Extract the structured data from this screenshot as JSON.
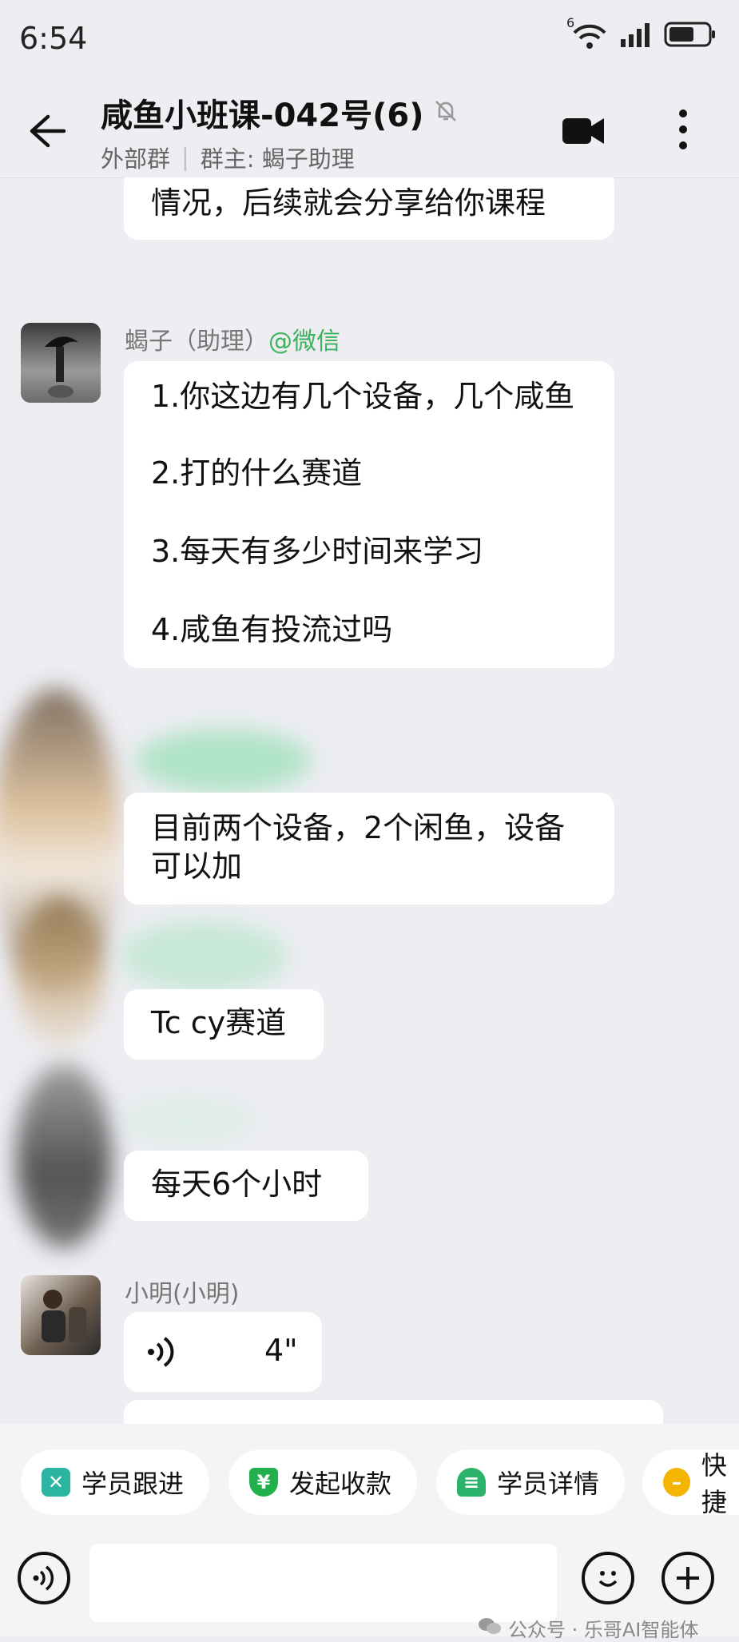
{
  "status": {
    "time": "6:54",
    "network": "6"
  },
  "header": {
    "title": "咸鱼小班课-042号(6)",
    "subtitle_type": "外部群",
    "subtitle_owner": "群主: 蝎子助理",
    "icons": {
      "back": "back-arrow-icon",
      "mute": "mute-bell-icon",
      "video": "video-call-icon",
      "more": "more-vertical-icon"
    }
  },
  "messages": {
    "m0": {
      "text": "情况，后续就会分享给你课程"
    },
    "m1": {
      "sender": "蝎子（助理）",
      "mention": "@微信",
      "lines": [
        "1.你这边有几个设备，几个咸鱼",
        "2.打的什么赛道",
        "3.每天有多少时间来学习",
        "4.咸鱼有投流过吗"
      ]
    },
    "m2": {
      "text": "目前两个设备，2个闲鱼，设备可以加"
    },
    "m3": {
      "text": "Tc cy赛道"
    },
    "m4": {
      "text": "每天6个小时"
    },
    "m5": {
      "sender": "小明(小明)",
      "duration": "4\""
    }
  },
  "quick_actions": [
    {
      "label": "学员跟进",
      "color": "#2bb5a0"
    },
    {
      "label": "发起收款",
      "color": "#22b04d"
    },
    {
      "label": "学员详情",
      "color": "#2bb36b"
    },
    {
      "label": "快捷",
      "color": "#f5b400"
    }
  ],
  "input": {
    "voice_icon": "voice-input-icon",
    "emoji_icon": "emoji-icon",
    "plus_icon": "plus-icon"
  },
  "watermark": {
    "text": "公众号 · 乐哥AI智能体"
  }
}
